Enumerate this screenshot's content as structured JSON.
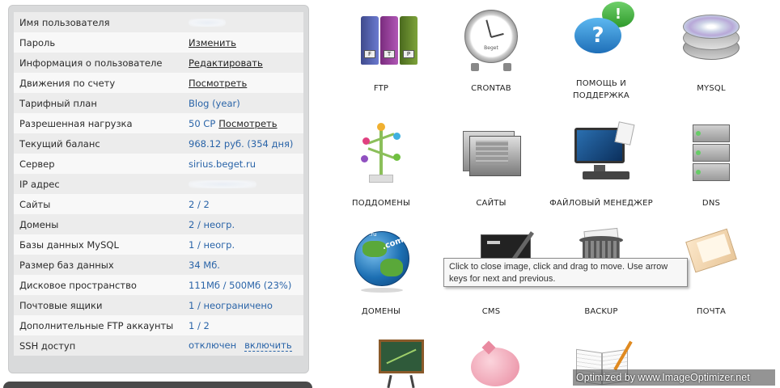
{
  "account": {
    "rows": [
      {
        "label": "Имя пользователя",
        "value": ""
      },
      {
        "label": "Пароль",
        "link": "Изменить"
      },
      {
        "label": "Информация о пользователе",
        "link": "Редактировать"
      },
      {
        "label": "Движения по счету",
        "link": "Посмотреть"
      },
      {
        "label": "Тарифный план",
        "value": "Blog (year)"
      },
      {
        "label": "Разрешенная нагрузка",
        "value": "50 CP",
        "link": "Посмотреть"
      },
      {
        "label": "Текущий баланс",
        "value": "968.12 руб. (354 дня)"
      },
      {
        "label": "Сервер",
        "value": "sirius.beget.ru"
      },
      {
        "label": "IP адрес",
        "value": ""
      },
      {
        "label": "Сайты",
        "value": "2 / 2"
      },
      {
        "label": "Домены",
        "value": "2 / неогр."
      },
      {
        "label": "Базы данных MySQL",
        "value": "1 / неогр."
      },
      {
        "label": "Размер баз данных",
        "value": "34 Мб."
      },
      {
        "label": "Дисковое пространство",
        "value": "111Мб / 500Мб (23%)"
      },
      {
        "label": "Почтовые ящики",
        "value": "1 / неограничено"
      },
      {
        "label": "Дополнительные FTP аккаунты",
        "value": "1 / 2"
      },
      {
        "label": "SSH доступ",
        "value": "отключен",
        "link": "включить"
      }
    ]
  },
  "tiles": {
    "ftp": {
      "label": "FTP",
      "icon": "binders-icon",
      "binder_letters": [
        "F",
        "T",
        "P"
      ]
    },
    "crontab": {
      "label": "CRONTAB",
      "icon": "clock-icon",
      "clock_text": "Beget"
    },
    "help": {
      "label_line1": "ПОМОЩЬ И",
      "label_line2": "ПОДДЕРЖКА",
      "icon": "speech-bubbles-icon",
      "glyph_1": "!",
      "glyph_2": "?"
    },
    "mysql": {
      "label": "MYSQL",
      "icon": "database-disks-icon"
    },
    "subdomains": {
      "label": "ПОДДОМЕНЫ",
      "icon": "tree-icon"
    },
    "sites": {
      "label": "САЙТЫ",
      "icon": "folders-icon"
    },
    "filemanager": {
      "label": "ФАЙЛОВЫЙ МЕНЕДЖЕР",
      "icon": "computer-icon"
    },
    "dns": {
      "label": "DNS",
      "icon": "server-rack-icon"
    },
    "domains": {
      "label": "ДОМЕНЫ",
      "icon": "globe-icon",
      "globe_text_1": ".com",
      "globe_text_2": ".ru"
    },
    "cms": {
      "label": "CMS",
      "icon": "tools-icon"
    },
    "backup": {
      "label": "BACKUP",
      "icon": "trash-bin-icon"
    },
    "mail": {
      "label": "ПОЧТА",
      "icon": "envelope-icon"
    },
    "stats": {
      "icon": "chalkboard-chart-icon"
    },
    "payment": {
      "icon": "piggy-bank-icon"
    },
    "docs": {
      "icon": "open-book-icon"
    }
  },
  "tooltip": {
    "line1": "Click to close image, click and drag to move. Use arrow",
    "line2": "keys for next and previous."
  },
  "watermark": "Optimized by www.ImageOptimizer.net",
  "colors": {
    "link_blue": "#2a64a8",
    "panel_bg": "#d9dadb"
  }
}
